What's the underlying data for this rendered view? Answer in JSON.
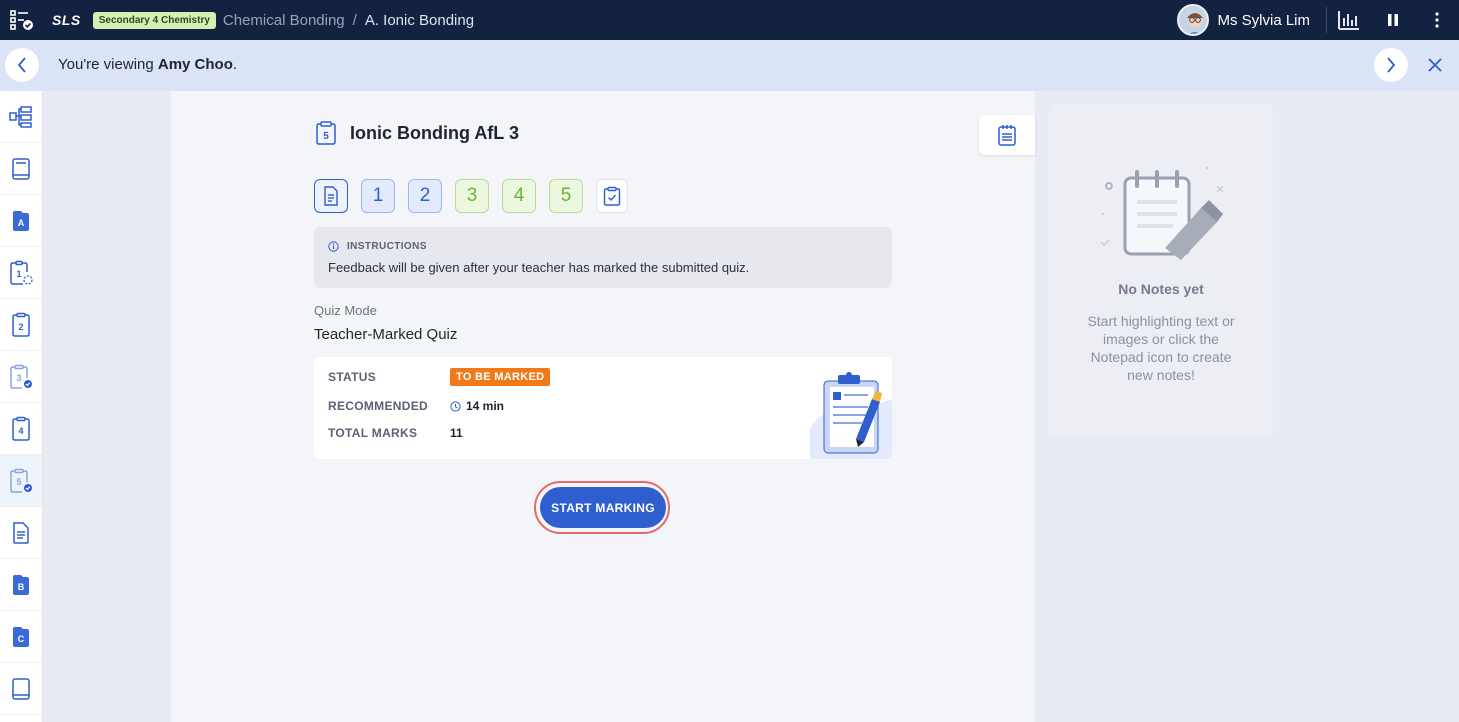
{
  "topbar": {
    "logo": "SLS",
    "subject_badge": "Secondary 4 Chemistry",
    "breadcrumb": [
      "Chemical Bonding",
      "A. Ionic Bonding"
    ],
    "breadcrumb_separator": "/",
    "user_name": "Ms Sylvia Lim",
    "icons": [
      "apps-menu-icon",
      "analytics-icon",
      "pause-icon",
      "more-vertical-icon"
    ]
  },
  "banner": {
    "prefix": "You're viewing ",
    "student": "Amy Choo",
    "suffix": ".",
    "icons": [
      "chevron-left-icon",
      "chevron-right-icon",
      "close-icon"
    ]
  },
  "sidebar": {
    "items": [
      {
        "icon": "lesson-map-icon"
      },
      {
        "icon": "book-icon"
      },
      {
        "icon": "section-a-icon",
        "glyph": "A"
      },
      {
        "icon": "quiz-1-icon",
        "glyph": "1"
      },
      {
        "icon": "quiz-2-icon",
        "glyph": "2"
      },
      {
        "icon": "quiz-3-icon",
        "glyph": "3"
      },
      {
        "icon": "quiz-4-icon",
        "glyph": "4"
      },
      {
        "icon": "quiz-5-icon",
        "glyph": "5",
        "active": true
      },
      {
        "icon": "document-icon"
      },
      {
        "icon": "section-b-icon",
        "glyph": "B"
      },
      {
        "icon": "section-c-icon",
        "glyph": "C"
      },
      {
        "icon": "book-end-icon"
      }
    ]
  },
  "quiz": {
    "badge_number": "5",
    "title": "Ionic Bonding AfL 3",
    "steps": [
      "1",
      "2",
      "3",
      "4",
      "5"
    ],
    "instructions_label": "INSTRUCTIONS",
    "instructions_text": "Feedback will be given after your teacher has marked the submitted quiz.",
    "mode_label": "Quiz Mode",
    "mode_value": "Teacher-Marked Quiz",
    "status_label": "STATUS",
    "status_value": "TO BE MARKED",
    "recommended_label": "RECOMMENDED",
    "recommended_value": "14 min",
    "total_marks_label": "TOTAL MARKS",
    "total_marks_value": "11",
    "start_button": "START MARKING"
  },
  "notes": {
    "heading": "No Notes yet",
    "body": "Start highlighting text or images or click the Notepad icon to create new notes!"
  },
  "colors": {
    "topbar_bg": "#132241",
    "banner_bg": "#dbe3f7",
    "primary_blue": "#2f5ecf",
    "green": "#6ab431",
    "status_orange": "#f07a1a",
    "focus_ring": "#e06a6e"
  }
}
